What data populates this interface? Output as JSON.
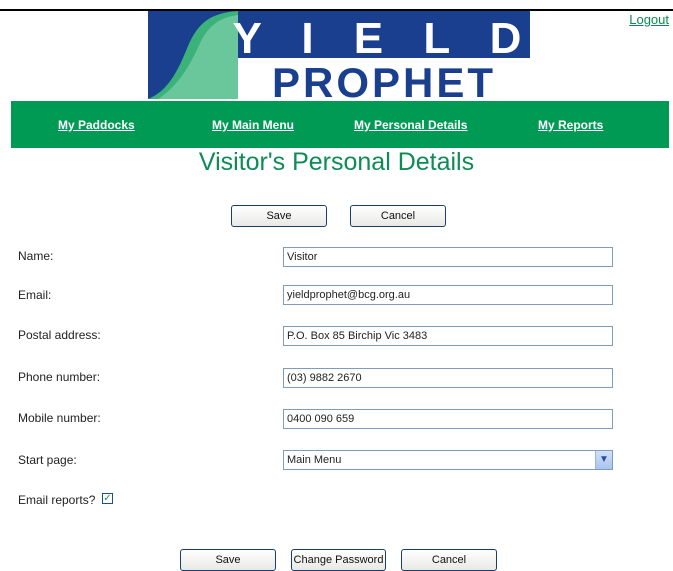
{
  "header": {
    "logout_label": "Logout",
    "logo_line1": "Y I E L D",
    "logo_line2": "PROPHET"
  },
  "nav": {
    "items": [
      {
        "label": "My Paddocks"
      },
      {
        "label": "My Main Menu"
      },
      {
        "label": "My Personal Details"
      },
      {
        "label": "My Reports"
      }
    ]
  },
  "page": {
    "title": "Visitor's Personal Details"
  },
  "top_buttons": {
    "save_label": "Save",
    "cancel_label": "Cancel"
  },
  "form": {
    "name": {
      "label": "Name:",
      "value": "Visitor"
    },
    "email": {
      "label": "Email:",
      "value": "yieldprophet@bcg.org.au"
    },
    "postal": {
      "label": "Postal address:",
      "value": "P.O. Box 85 Birchip Vic 3483"
    },
    "phone": {
      "label": "Phone number:",
      "value": "(03) 9882 2670"
    },
    "mobile": {
      "label": "Mobile number:",
      "value": "0400 090 659"
    },
    "start_page": {
      "label": "Start page:",
      "value": "Main Menu"
    },
    "email_reports": {
      "label": "Email reports?",
      "checked": true
    }
  },
  "bottom_buttons": {
    "save_label": "Save",
    "change_password_label": "Change Password",
    "cancel_label": "Cancel"
  },
  "colors": {
    "nav_green": "#009a55",
    "title_green": "#0e8c55",
    "logo_blue": "#1b3f8f"
  }
}
